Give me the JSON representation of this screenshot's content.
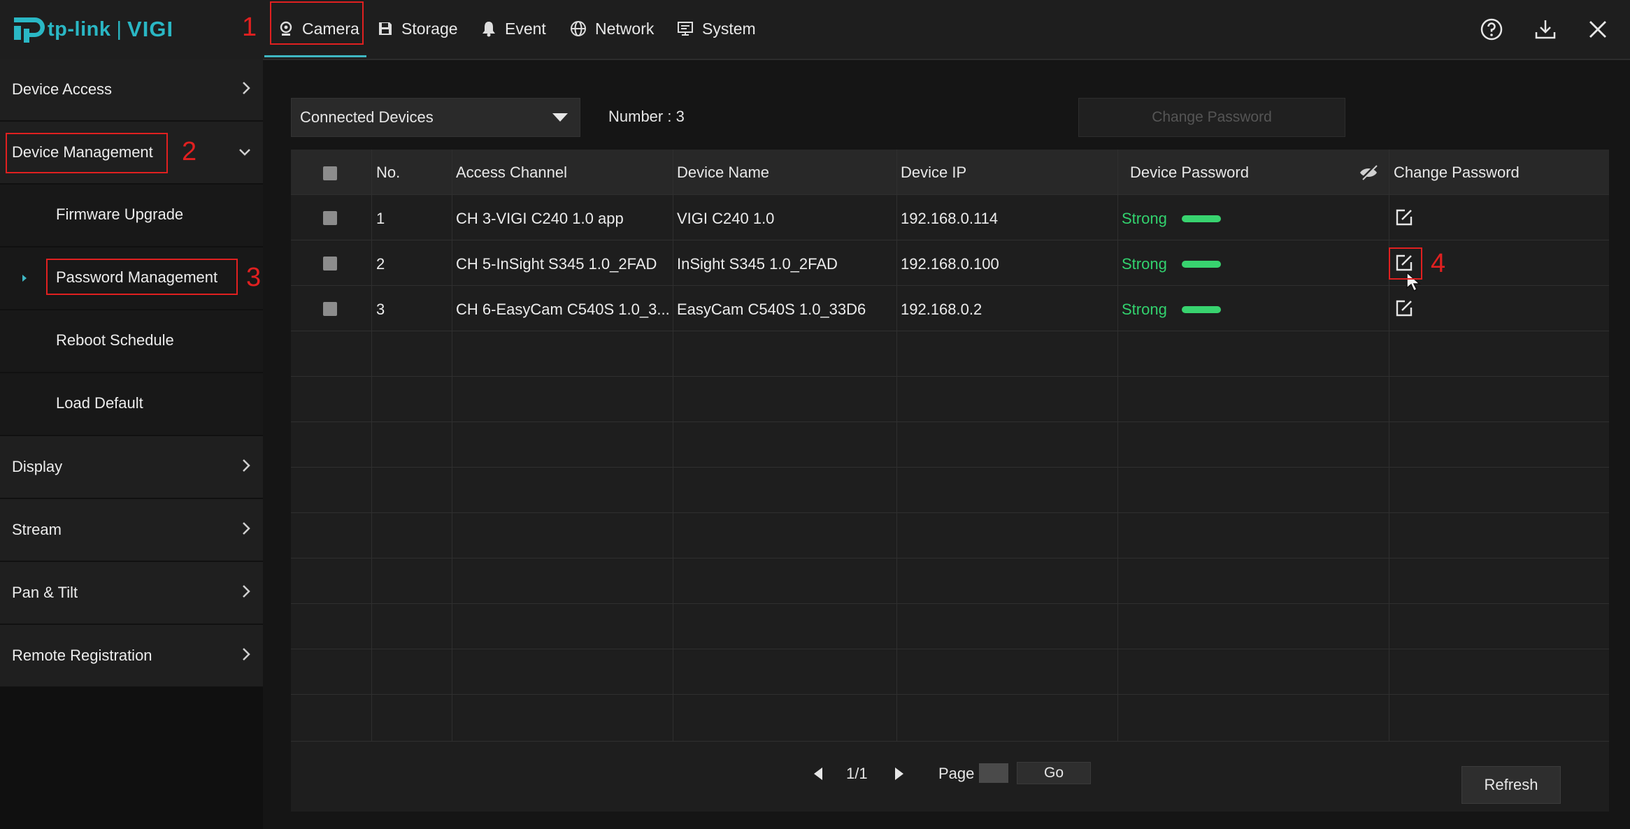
{
  "app": {
    "logo_brand": "tp-link",
    "logo_product": "VIGI"
  },
  "tabs": [
    {
      "label": "Camera",
      "icon": "camera-icon",
      "active": true
    },
    {
      "label": "Storage",
      "icon": "storage-icon"
    },
    {
      "label": "Event",
      "icon": "bell-icon"
    },
    {
      "label": "Network",
      "icon": "globe-icon"
    },
    {
      "label": "System",
      "icon": "monitor-icon"
    }
  ],
  "top_icons": [
    "help-icon",
    "download-icon",
    "close-icon"
  ],
  "sidebar": {
    "items": [
      {
        "label": "Device Access"
      },
      {
        "label": "Device Management",
        "expanded": true
      },
      {
        "label": "Display"
      },
      {
        "label": "Stream"
      },
      {
        "label": "Pan & Tilt"
      },
      {
        "label": "Remote Registration"
      }
    ],
    "sub_items": [
      {
        "label": "Firmware Upgrade"
      },
      {
        "label": "Password Management",
        "selected": true
      },
      {
        "label": "Reboot Schedule"
      },
      {
        "label": "Load Default"
      }
    ]
  },
  "toolbar": {
    "device_filter": "Connected Devices",
    "number_label": "Number : 3",
    "change_password_button": "Change Password"
  },
  "table": {
    "columns": [
      "No.",
      "Access Channel",
      "Device Name",
      "Device IP",
      "Device Password",
      "Change Password"
    ],
    "rows": [
      {
        "no": "1",
        "channel": "CH 3-VIGI C240 1.0 app",
        "name": "VIGI C240 1.0",
        "ip": "192.168.0.114",
        "password": "Strong"
      },
      {
        "no": "2",
        "channel": "CH 5-InSight S345 1.0_2FAD",
        "name": "InSight S345 1.0_2FAD",
        "ip": "192.168.0.100",
        "password": "Strong"
      },
      {
        "no": "3",
        "channel": "CH 6-EasyCam C540S 1.0_3...",
        "name": "EasyCam C540S 1.0_33D6",
        "ip": "192.168.0.2",
        "password": "Strong"
      }
    ]
  },
  "pagination": {
    "current": "1/1",
    "page_label": "Page",
    "go_label": "Go"
  },
  "refresh_label": "Refresh",
  "annotations": [
    "1",
    "2",
    "3",
    "4"
  ],
  "colors": {
    "accent": "#3fb7c3",
    "strong": "#32d26e",
    "annotation": "#e02020"
  }
}
